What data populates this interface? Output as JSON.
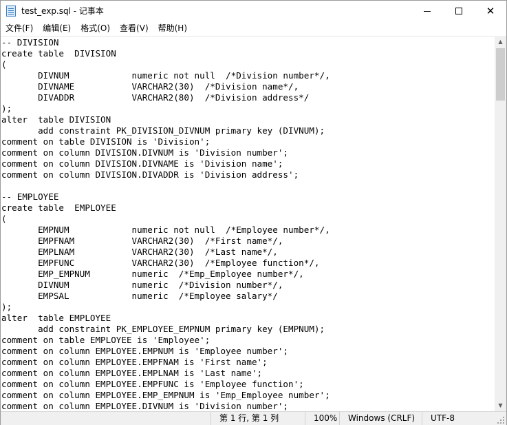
{
  "window": {
    "title": "test_exp.sql - 记事本"
  },
  "controls": {
    "minimize": "─",
    "maximize": "□",
    "close": "✕"
  },
  "menu": [
    "文件(F)",
    "编辑(E)",
    "格式(O)",
    "查看(V)",
    "帮助(H)"
  ],
  "editor": {
    "content": "-- DIVISION\ncreate table  DIVISION\n(\n       DIVNUM            numeric not null  /*Division number*/,\n       DIVNAME           VARCHAR2(30)  /*Division name*/,\n       DIVADDR           VARCHAR2(80)  /*Division address*/\n);\nalter  table DIVISION\n       add constraint PK_DIVISION_DIVNUM primary key (DIVNUM);\ncomment on table DIVISION is 'Division';\ncomment on column DIVISION.DIVNUM is 'Division number';\ncomment on column DIVISION.DIVNAME is 'Division name';\ncomment on column DIVISION.DIVADDR is 'Division address';\n\n-- EMPLOYEE\ncreate table  EMPLOYEE\n(\n       EMPNUM            numeric not null  /*Employee number*/,\n       EMPFNAM           VARCHAR2(30)  /*First name*/,\n       EMPLNAM           VARCHAR2(30)  /*Last name*/,\n       EMPFUNC           VARCHAR2(30)  /*Employee function*/,\n       EMP_EMPNUM        numeric  /*Emp_Employee number*/,\n       DIVNUM            numeric  /*Division number*/,\n       EMPSAL            numeric  /*Employee salary*/\n);\nalter  table EMPLOYEE\n       add constraint PK_EMPLOYEE_EMPNUM primary key (EMPNUM);\ncomment on table EMPLOYEE is 'Employee';\ncomment on column EMPLOYEE.EMPNUM is 'Employee number';\ncomment on column EMPLOYEE.EMPFNAM is 'First name';\ncomment on column EMPLOYEE.EMPLNAM is 'Last name';\ncomment on column EMPLOYEE.EMPFUNC is 'Employee function';\ncomment on column EMPLOYEE.EMP_EMPNUM is 'Emp_Employee number';\ncomment on column EMPLOYEE.DIVNUM is 'Division number';"
  },
  "scrollbar": {
    "up_arrow": "▲",
    "down_arrow": "▼"
  },
  "status": {
    "position": "第 1 行, 第 1 列",
    "zoom": "100%",
    "line_ending": "Windows (CRLF)",
    "encoding": "UTF-8"
  }
}
